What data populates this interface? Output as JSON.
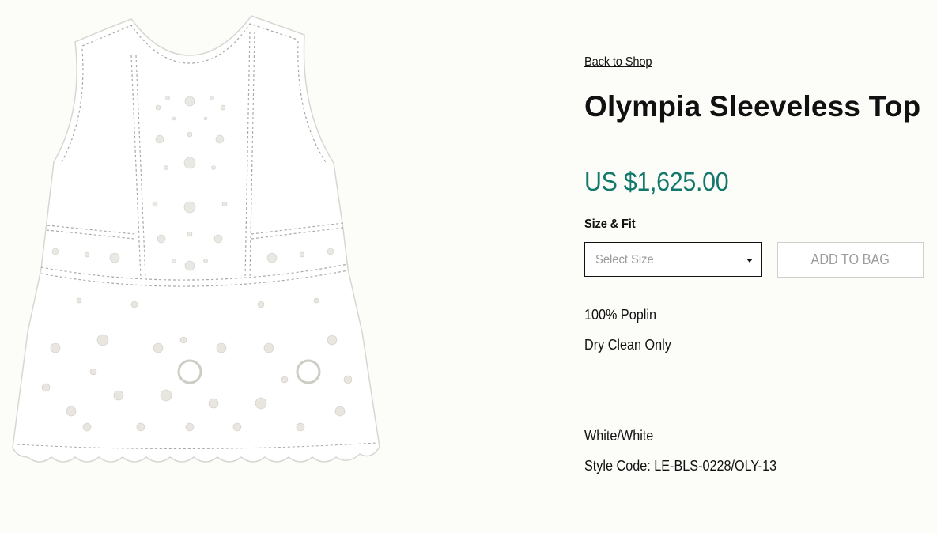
{
  "nav": {
    "back_label": "Back to Shop"
  },
  "product": {
    "title": "Olympia Sleeveless Top",
    "price": "US $1,625.00",
    "size_fit_label": "Size & Fit",
    "size_select": {
      "placeholder": "Select Size"
    },
    "add_to_bag_label": "ADD TO BAG",
    "material": "100% Poplin",
    "care": "Dry Clean Only",
    "color": "White/White",
    "style_code": "Style Code: LE-BLS-0228/OLY-13"
  },
  "image": {
    "icon": "product-photo",
    "subject": "white eyelet sleeveless top"
  },
  "colors": {
    "background": "#fcfcf9",
    "price": "#12786c",
    "text": "#111111",
    "button_border": "#cfcfcf",
    "button_text": "#9c9c9c"
  }
}
